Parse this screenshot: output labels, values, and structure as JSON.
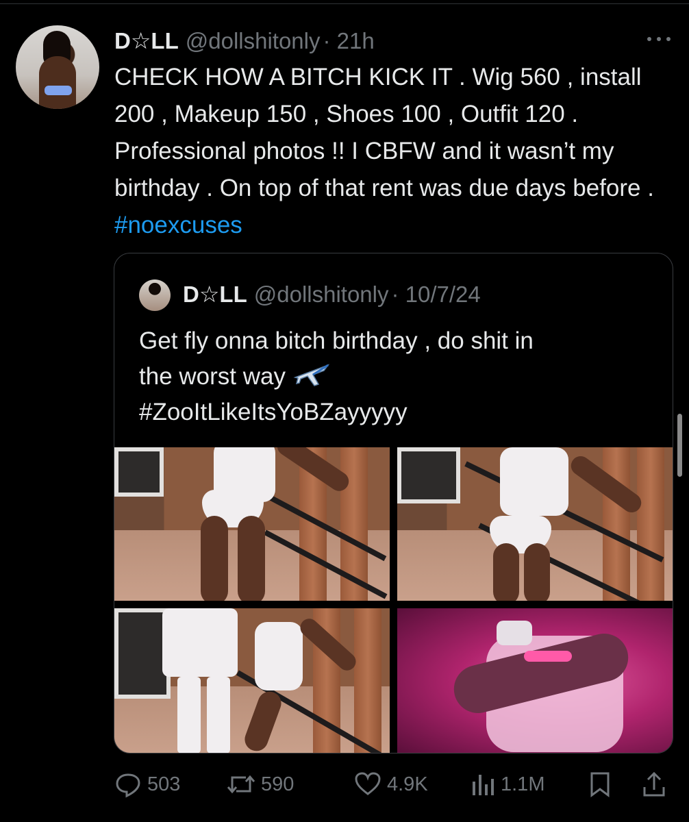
{
  "tweet": {
    "display_name": "D☆LL",
    "handle": "@dollshitonly",
    "time": "· 21h",
    "text_main": "CHECK HOW A BITCH KICK IT . Wig 560 , install 200 , Makeup 150 , Shoes 100 , Outfit 120 . Professional photos !! I CBFW and it wasn’t my birthday . On top of that rent was due days before . ",
    "hashtag": "#noexcuses",
    "more_icon": "more-horizontal-icon"
  },
  "quoted": {
    "display_name": "D☆LL",
    "handle": "@dollshitonly",
    "time": "· 10/7/24",
    "text_line1": "Get fly onna bitch birthday , do shit in",
    "text_line2": "the worst way",
    "hashtag": "#ZooItLikeItsYoBZayyyyy",
    "photos": [
      "photo-1",
      "photo-2",
      "photo-3",
      "photo-4"
    ]
  },
  "actions": {
    "replies": "503",
    "reposts": "590",
    "likes": "4.9K",
    "views": "1.1M"
  },
  "colors": {
    "background": "#000000",
    "text": "#e7e9ea",
    "secondary": "#71767b",
    "link": "#1d9bf0",
    "border": "#3a3d41"
  }
}
